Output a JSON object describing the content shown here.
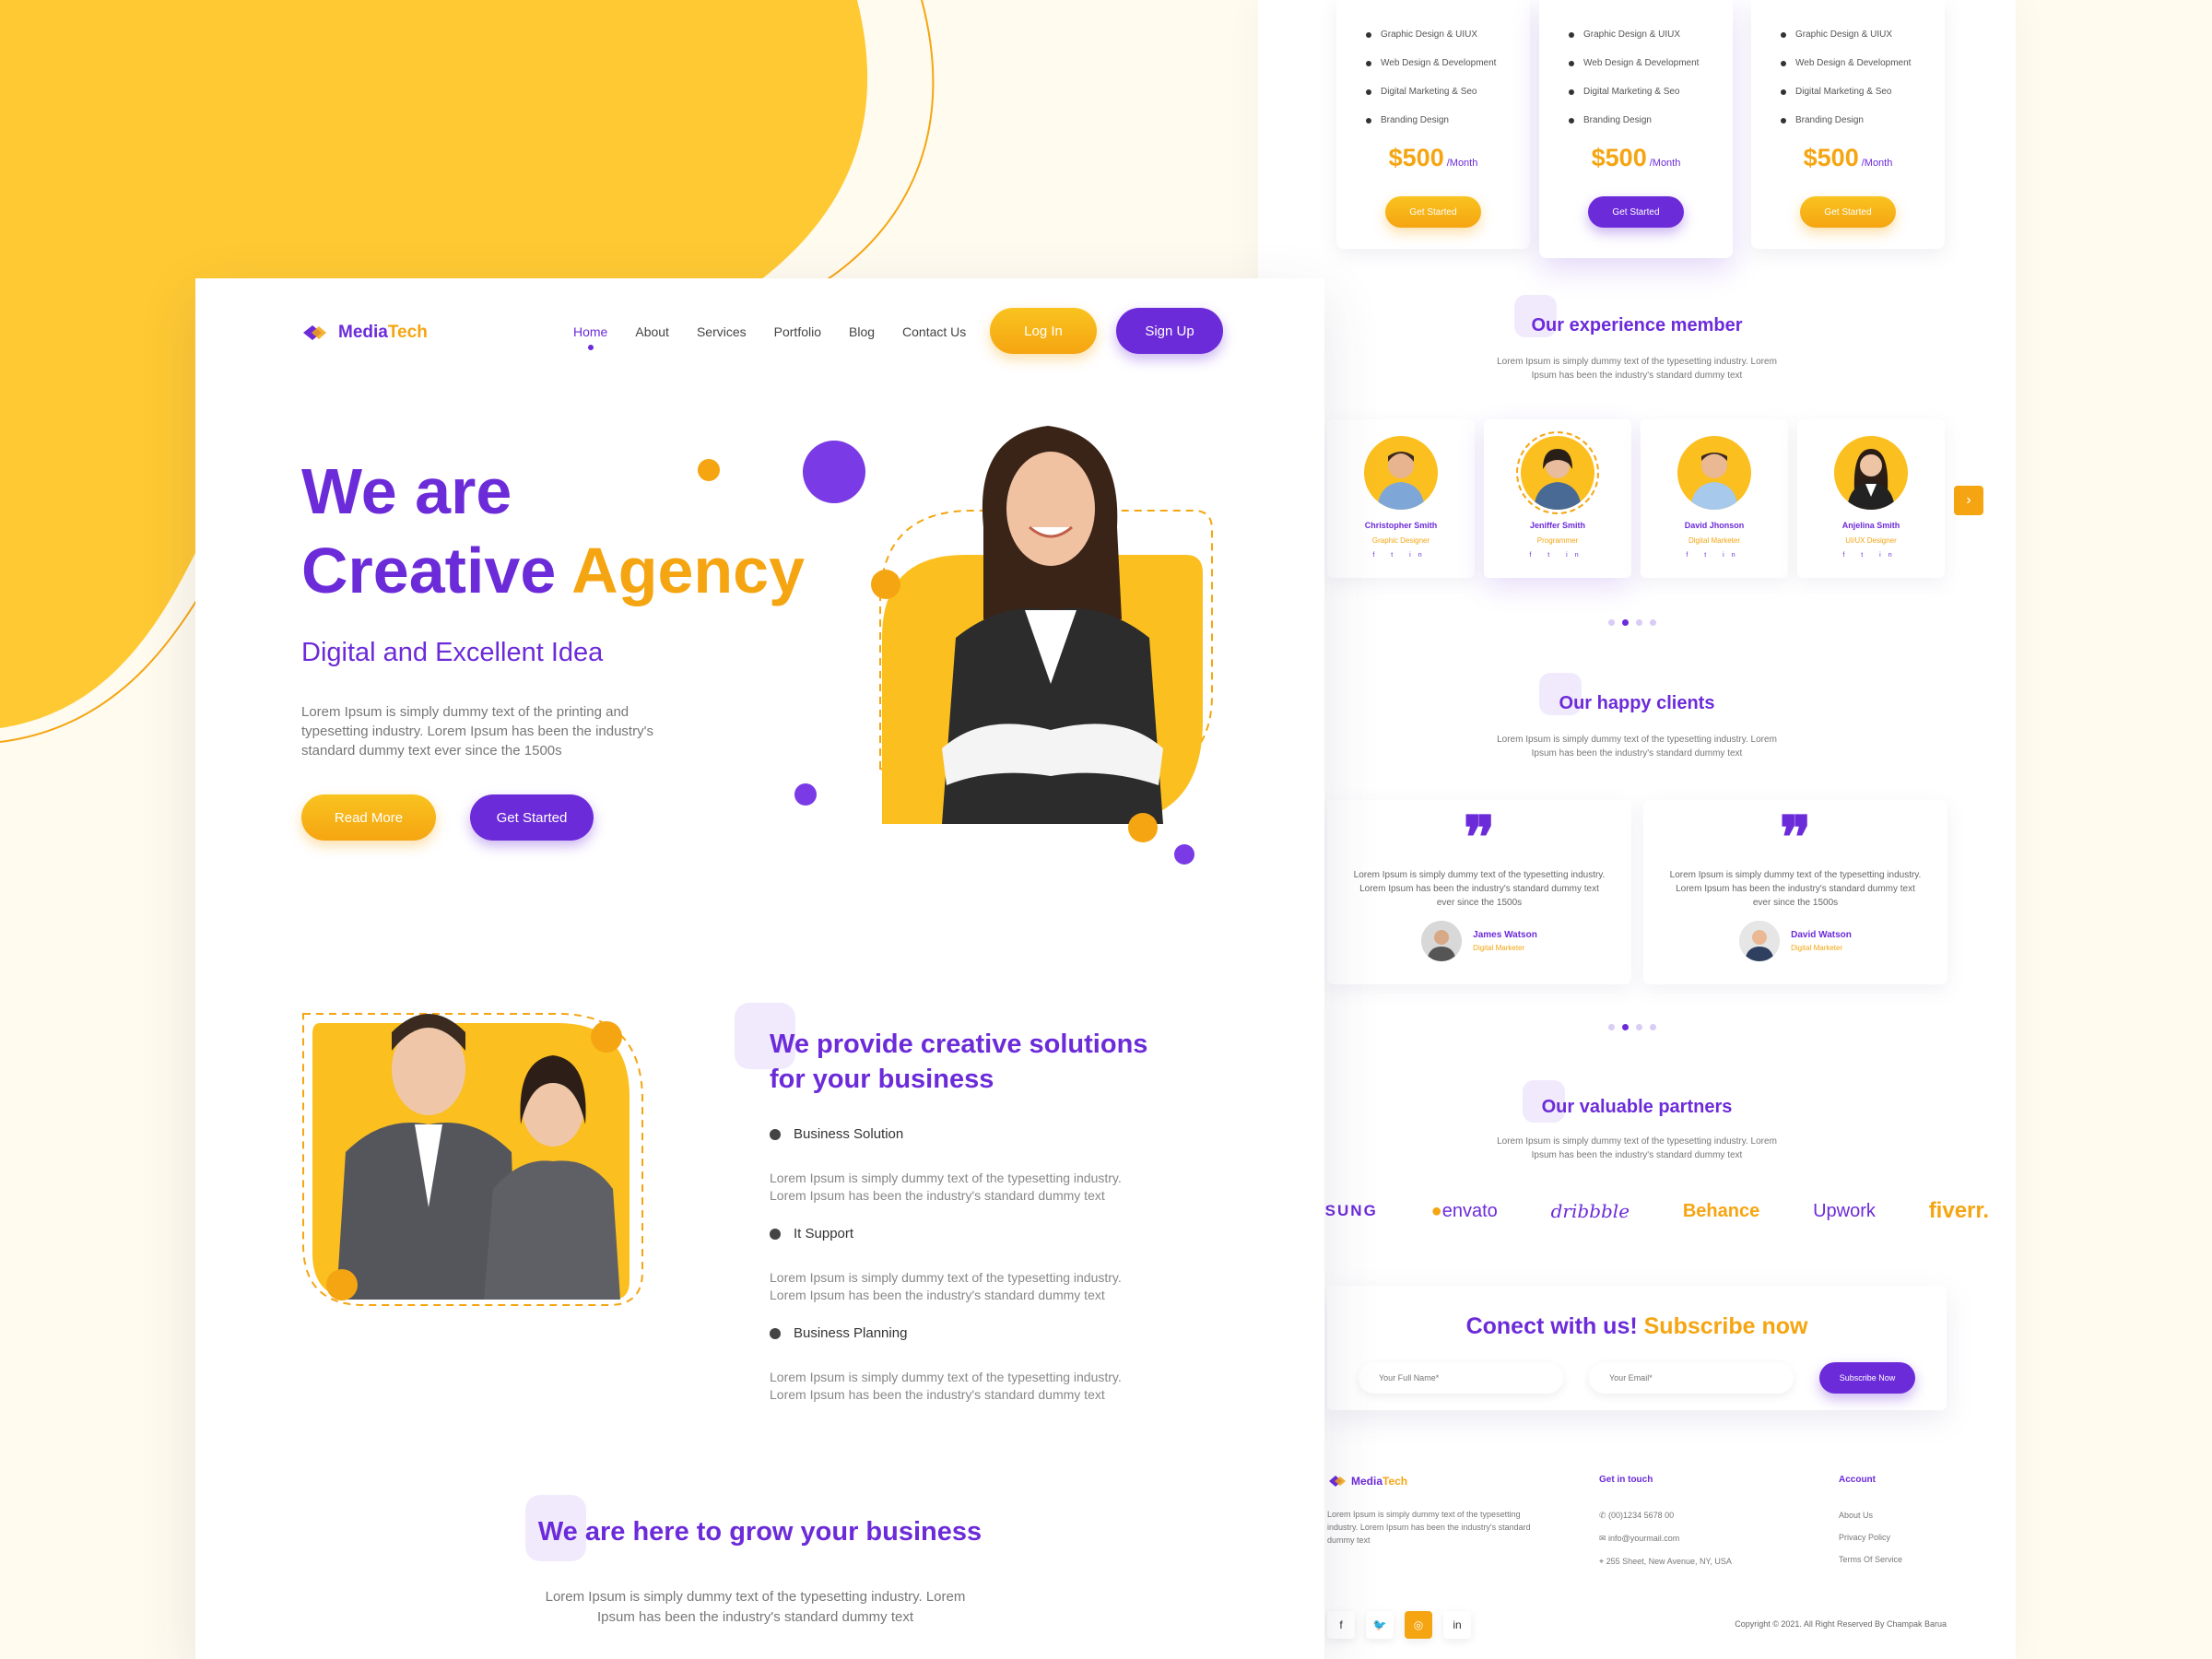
{
  "brand": {
    "name_part1": "Media",
    "name_part2": "Tech",
    "colors": {
      "purple": "#6c2bd9",
      "orange": "#f5a511",
      "yellow": "#fbbf1f",
      "bg": "#fffbef"
    }
  },
  "nav": {
    "items": [
      "Home",
      "About",
      "Services",
      "Portfolio",
      "Blog",
      "Contact Us"
    ],
    "active": "Home",
    "login_label": "Log In",
    "signup_label": "Sign Up"
  },
  "hero": {
    "line1": "We are",
    "line2a": "Creative",
    "line2b": "Agency",
    "subtitle": "Digital and Excellent Idea",
    "paragraph": "Lorem Ipsum is simply dummy text of the printing and typesetting industry. Lorem Ipsum has been the industry's standard dummy text ever since the 1500s",
    "read_more": "Read More",
    "get_started": "Get Started"
  },
  "solutions": {
    "title": "We provide creative solutions for your business",
    "items": [
      {
        "title": "Business Solution",
        "desc": "Lorem Ipsum is simply dummy text of the typesetting industry. Lorem Ipsum has been the industry's standard dummy text"
      },
      {
        "title": "It Support",
        "desc": "Lorem Ipsum is simply dummy text of the typesetting industry. Lorem Ipsum has been the industry's standard dummy text"
      },
      {
        "title": "Business Planning",
        "desc": "Lorem Ipsum is simply dummy text of the typesetting industry. Lorem Ipsum has been the industry's standard dummy text"
      }
    ]
  },
  "grow": {
    "title": "We are here to grow your business",
    "paragraph": "Lorem Ipsum is simply dummy text of the typesetting industry. Lorem Ipsum has been the industry's standard dummy text"
  },
  "pricing": {
    "features": [
      "Graphic Design & UIUX",
      "Web Design & Development",
      "Digital Marketing & Seo",
      "Branding Design"
    ],
    "price": "$500",
    "period": "/Month",
    "button": "Get Started"
  },
  "members": {
    "title": "Our experience member",
    "paragraph": "Lorem Ipsum is simply dummy text of the typesetting industry. Lorem Ipsum has been the industry's standard dummy text",
    "list": [
      {
        "name": "Christopher Smith",
        "role": "Graphic Designer"
      },
      {
        "name": "Jeniffer Smith",
        "role": "Programmer"
      },
      {
        "name": "David Jhonson",
        "role": "Digital Marketer"
      },
      {
        "name": "Anjelina Smith",
        "role": "UI/UX Designer"
      }
    ],
    "social": "f  t  in"
  },
  "clients": {
    "title": "Our happy clients",
    "paragraph": "Lorem Ipsum is simply dummy text of the typesetting industry. Lorem Ipsum has been the industry's standard dummy text",
    "testimonials": [
      {
        "text": "Lorem Ipsum is simply dummy text of the typesetting industry. Lorem Ipsum has been the industry's standard dummy text ever since the 1500s",
        "name": "James Watson",
        "role": "Digital Marketer"
      },
      {
        "text": "Lorem Ipsum is simply dummy text of the typesetting industry. Lorem Ipsum has been the industry's standard dummy text ever since the 1500s",
        "name": "David Watson",
        "role": "Digital Marketer"
      }
    ]
  },
  "partners": {
    "title": "Our valuable partners",
    "paragraph": "Lorem Ipsum is simply dummy text of the typesetting industry. Lorem Ipsum has been the industry's standard dummy text",
    "logos": [
      "SAMSUNG",
      "envato",
      "dribbble",
      "Behance",
      "Upwork",
      "fiverr."
    ]
  },
  "subscribe": {
    "title_a": "Conect with us!",
    "title_b": "Subscribe now",
    "name_placeholder": "Your Full Name*",
    "email_placeholder": "Your Email*",
    "button": "Subscribe Now"
  },
  "footer": {
    "about": "Lorem Ipsum is simply dummy text of the typesetting industry. Lorem Ipsum has been the industry's standard dummy text",
    "contact_title": "Get in touch",
    "phone": "(00)1234 5678 00",
    "email": "info@yourmail.com",
    "address": "255 Sheet, New Avenue, NY, USA",
    "account_title": "Account",
    "account_links": [
      "About Us",
      "Privacy Policy",
      "Terms Of Service"
    ],
    "copyright": "Copyright © 2021. All Right Reserved By Champak Barua",
    "social_icons": [
      "facebook-icon",
      "twitter-icon",
      "instagram-icon",
      "linkedin-icon"
    ]
  }
}
